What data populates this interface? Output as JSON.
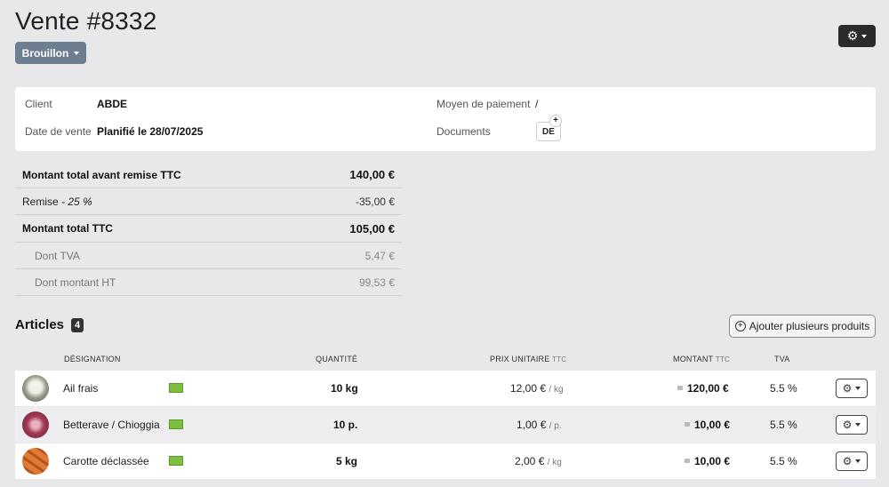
{
  "header": {
    "title": "Vente #8332",
    "status_label": "Brouillon",
    "settings_icon": "gear-icon"
  },
  "info": {
    "client_label": "Client",
    "client_value": "ABDE",
    "date_label": "Date de vente",
    "date_value": "Planifié le 28/07/2025",
    "payment_label": "Moyen de paiement",
    "payment_value": "/",
    "documents_label": "Documents",
    "document_chip": "DE",
    "document_add": "+"
  },
  "totals": {
    "before_discount_label": "Montant total avant remise TTC",
    "before_discount_value": "140,00 €",
    "discount_label": "Remise",
    "discount_rate": "- 25 %",
    "discount_value": "-35,00 €",
    "total_label": "Montant total TTC",
    "total_value": "105,00 €",
    "vat_label": "Dont TVA",
    "vat_value": "5,47 €",
    "ht_label": "Dont montant HT",
    "ht_value": "99,53 €"
  },
  "articles": {
    "title": "Articles",
    "count": "4",
    "add_button": "Ajouter plusieurs produits",
    "columns": {
      "designation": "DÉSIGNATION",
      "quantity": "QUANTITÉ",
      "unit_price": "PRIX UNITAIRE",
      "unit_price_suffix": "TTC",
      "amount": "MONTANT",
      "amount_suffix": "TTC",
      "vat": "TVA"
    },
    "rows": [
      {
        "name": "Ail frais",
        "quantity": "10 kg",
        "price": "12,00 €",
        "price_unit": "/ kg",
        "amount": "120,00 €",
        "vat": "5.5 %",
        "thumb_color": "#c9c9bf"
      },
      {
        "name": "Betterave / Chioggia",
        "quantity": "10 p.",
        "price": "1,00 €",
        "price_unit": "/ p.",
        "amount": "10,00 €",
        "vat": "5.5 %",
        "thumb_color": "#a33a55"
      },
      {
        "name": "Carotte déclassée",
        "quantity": "5 kg",
        "price": "2,00 €",
        "price_unit": "/ kg",
        "amount": "10,00 €",
        "vat": "5.5 %",
        "thumb_color": "#d2692a"
      }
    ]
  }
}
